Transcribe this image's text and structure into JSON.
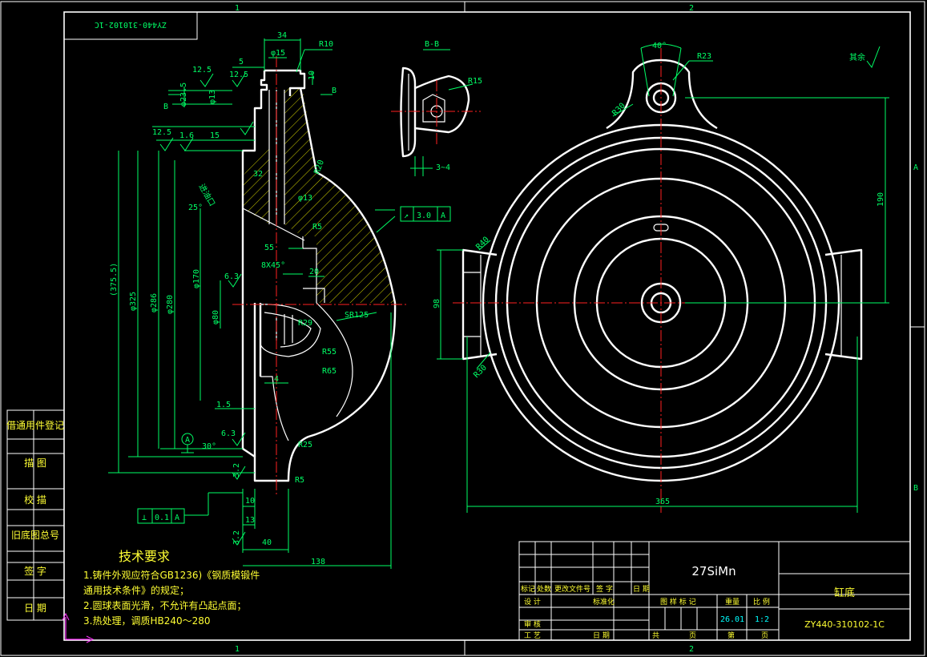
{
  "sheet": {
    "zone_cols": [
      "1",
      "2"
    ],
    "zone_rows": [
      "A",
      "B"
    ],
    "drawing_number": "ZY440-310102-1C",
    "drawing_number_mirrored": "ZY440-310102-1C",
    "general_roughness_note": "其余"
  },
  "left_strip": {
    "items": [
      "借通用件登记",
      "描 图",
      "校 描",
      "旧底图总号",
      "签 字",
      "日 期"
    ]
  },
  "tech_requirements": {
    "title": "技术要求",
    "lines": [
      "1.铸件外观应符合GB1236)《钢质模锻件",
      "  通用技术条件》的规定；",
      "2.圆球表面光滑，不允许有凸起点面；",
      "3.热处理，调质HB240～280"
    ]
  },
  "title_block": {
    "material": "27SiMn",
    "part_name": "缸底",
    "drawing_no": "ZY440-310102-1C",
    "weight": "26.01",
    "scale": "1:2",
    "labels": {
      "mark": "标记",
      "count": "处数",
      "change_doc": "更改文件号",
      "sign": "签 字",
      "date": "日 期",
      "design": "设 计",
      "standardize": "标准化",
      "review": "审 核",
      "process": "工 艺",
      "date2": "日 期",
      "stage_mark": "图 样 标 记",
      "weight_lbl": "重量",
      "scale_lbl": "比 例",
      "sheet_total": "共",
      "sheet_unit": "页",
      "sheet_num": "第",
      "sheet_unit2": "页"
    }
  },
  "section_view": {
    "title": "B-B",
    "labels": {
      "d34": "34",
      "r10": "R10",
      "d5": "5",
      "phi15": "φ15",
      "d10": "10",
      "ra125_a": "12.5",
      "ra125_b": "12.5",
      "ra125_c": "12.5",
      "ra16": "1.6",
      "phi235": "φ23.5",
      "phi13a": "φ13",
      "b_left": "B",
      "b_right": "B",
      "d15": "15",
      "d32": "32",
      "r20": "R20",
      "phi13b": "φ13",
      "r5a": "R5",
      "s55": "55",
      "ra63a": "6.3",
      "ra63b": "6.3",
      "chamfer": "8X45°",
      "d20": "20",
      "sr125": "SR125",
      "r29": "R29",
      "r55": "R55",
      "r65": "R65",
      "d4": "4",
      "d15b": "1.5",
      "r25": "R25",
      "r5b": "R5",
      "ra32a": "3.2",
      "ra32b": "3.2",
      "d10b": "10",
      "d13": "13",
      "d40": "40",
      "d138": "138",
      "dim3755": "(375.5)",
      "phi325": "φ325",
      "phi286": "φ286",
      "phi280": "φ280",
      "phi170": "φ170",
      "phi80": "φ80",
      "datum": "A",
      "ang30": "30°",
      "tol_sym": "⊥",
      "tol_val": "0.1",
      "tol_ref": "A",
      "runout_sym": "↗",
      "runout_val": "3.0",
      "runout_ref": "A",
      "ang25": "25°",
      "note_vertical": "进油口"
    }
  },
  "bb_detail": {
    "r15": "R15",
    "d34": "3~4"
  },
  "front_view": {
    "ang40": "40°",
    "r23": "R23",
    "r30a": "R30",
    "d190": "190",
    "d98": "98",
    "r30b": "R30",
    "r40": "R40",
    "d365": "365"
  }
}
